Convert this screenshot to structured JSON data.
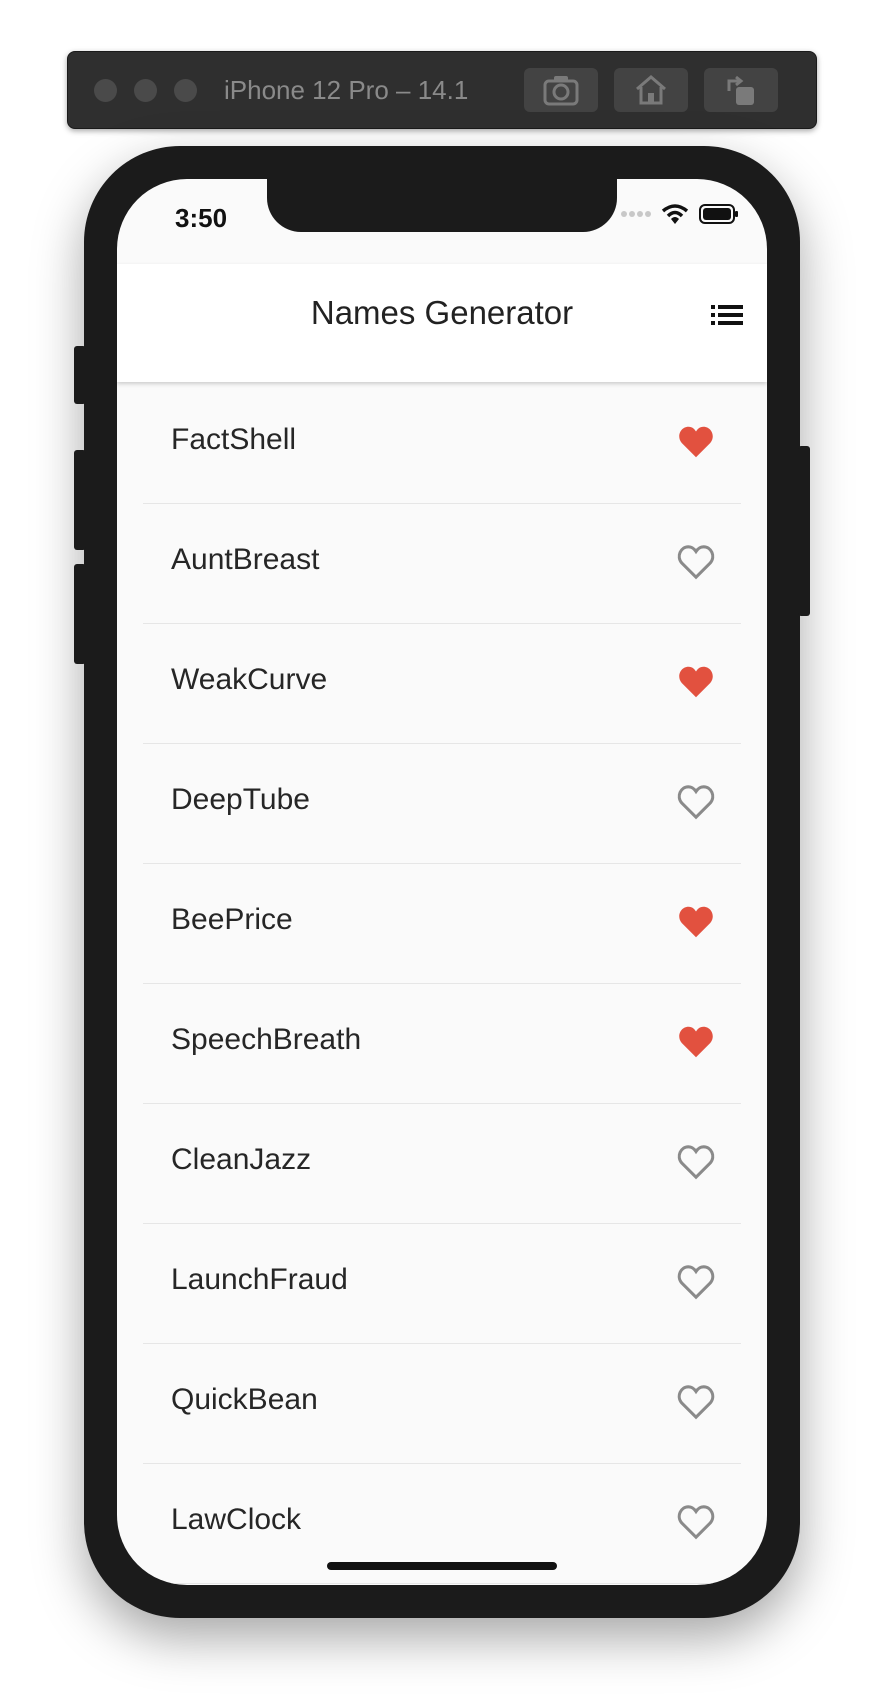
{
  "simulator": {
    "title": "iPhone 12 Pro – 14.1"
  },
  "status_bar": {
    "time": "3:50"
  },
  "app_bar": {
    "title": "Names Generator",
    "action_icon": "list-icon"
  },
  "colors": {
    "favorite": "#e2513f",
    "not_favorite": "#8a8a8a"
  },
  "names": [
    {
      "label": "FactShell",
      "favorite": true
    },
    {
      "label": "AuntBreast",
      "favorite": false
    },
    {
      "label": "WeakCurve",
      "favorite": true
    },
    {
      "label": "DeepTube",
      "favorite": false
    },
    {
      "label": "BeePrice",
      "favorite": true
    },
    {
      "label": "SpeechBreath",
      "favorite": true
    },
    {
      "label": "CleanJazz",
      "favorite": false
    },
    {
      "label": "LaunchFraud",
      "favorite": false
    },
    {
      "label": "QuickBean",
      "favorite": false
    },
    {
      "label": "LawClock",
      "favorite": false
    }
  ]
}
